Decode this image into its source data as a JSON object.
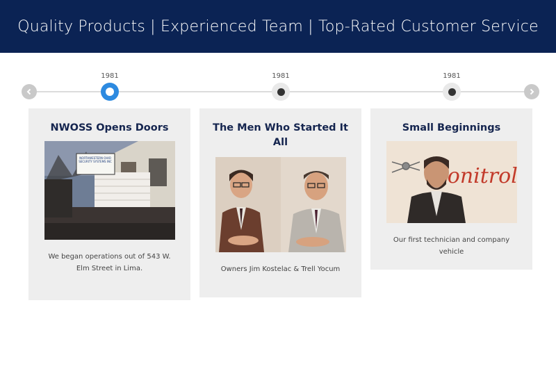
{
  "banner": {
    "text": "Quality Products | Experienced Team | Top-Rated Customer Service"
  },
  "timeline": {
    "prev_icon": "chevron-left-icon",
    "next_icon": "chevron-right-icon",
    "points": [
      {
        "year": "1981",
        "active": true
      },
      {
        "year": "1981",
        "active": false
      },
      {
        "year": "1981",
        "active": false
      }
    ]
  },
  "cards": [
    {
      "title": "NWOSS Opens Doors",
      "caption": "We began operations out of 543 W. Elm Street in Lima.",
      "photo_sign": "NORTHWESTERN OHIO SECURITY SYSTEMS INC",
      "photo_sign_sub": "SECURITY SYSTEMS"
    },
    {
      "title": "The Men Who Started It All",
      "caption": "Owners Jim Kostelac & Trell Yocum"
    },
    {
      "title": "Small Beginnings",
      "caption": "Our first technician and company vehicle",
      "photo_logo": "Sonitrol"
    }
  ],
  "colors": {
    "banner": "#0b2354",
    "active_dot": "#2d8ae0",
    "card_bg": "#eeeeee",
    "title": "#15254f"
  }
}
